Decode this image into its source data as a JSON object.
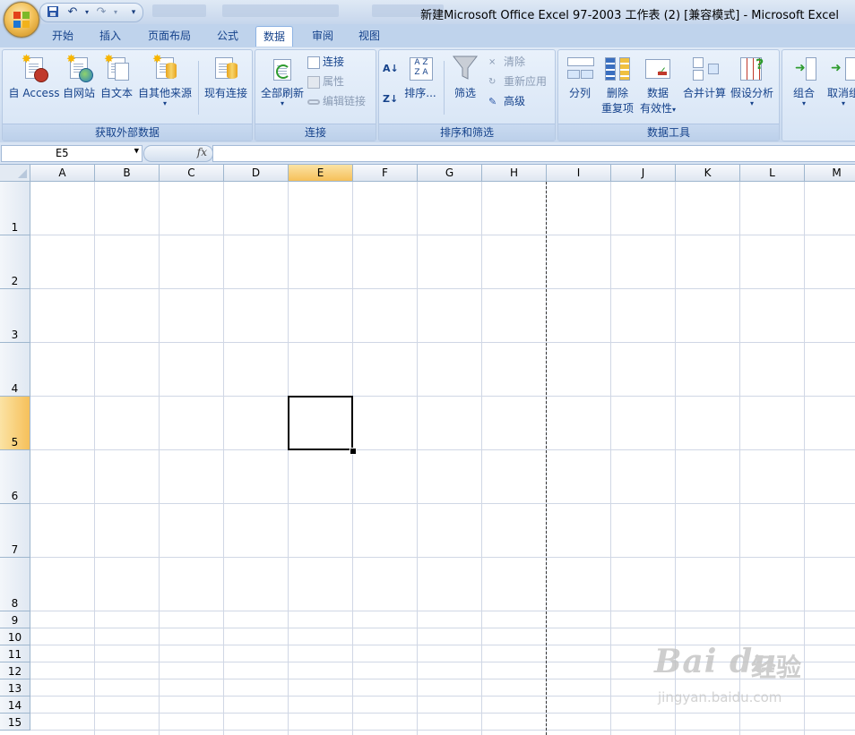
{
  "window": {
    "title": "新建Microsoft Office Excel 97-2003 工作表 (2)  [兼容模式] - Microsoft Excel"
  },
  "quick_access": {
    "icons": [
      "save-icon",
      "undo-icon",
      "redo-icon",
      "customize-icon"
    ]
  },
  "ribbon_tabs": [
    "开始",
    "插入",
    "页面布局",
    "公式",
    "数据",
    "审阅",
    "视图"
  ],
  "active_tab": "数据",
  "groups": {
    "external": {
      "label": "获取外部数据",
      "access": "自 Access",
      "web": "自网站",
      "text": "自文本",
      "other": "自其他来源",
      "existing": "现有连接"
    },
    "connections": {
      "label": "连接",
      "refresh_all": "全部刷新",
      "connections": "连接",
      "properties": "属性",
      "edit_links": "编辑链接"
    },
    "sort_filter": {
      "label": "排序和筛选",
      "sort": "排序...",
      "filter": "筛选",
      "clear": "清除",
      "reapply": "重新应用",
      "advanced": "高级"
    },
    "data_tools": {
      "label": "数据工具",
      "text_to_columns": "分列",
      "remove_dup_1": "删除",
      "remove_dup_2": "重复项",
      "validation_1": "数据",
      "validation_2": "有效性",
      "consolidate": "合并计算",
      "what_if": "假设分析"
    },
    "outline": {
      "group": "组合",
      "ungroup": "取消组"
    }
  },
  "formula_bar": {
    "name_box": "E5",
    "fx_label": "fx",
    "formula": ""
  },
  "sheet": {
    "columns": [
      "A",
      "B",
      "C",
      "D",
      "E",
      "F",
      "G",
      "H",
      "I",
      "J",
      "K",
      "L",
      "M"
    ],
    "rows": [
      "1",
      "2",
      "3",
      "4",
      "5",
      "6",
      "7",
      "8",
      "9",
      "10",
      "11",
      "12",
      "13",
      "14",
      "15"
    ],
    "selected_column": "E",
    "selected_row": "5"
  },
  "watermark": {
    "brand": "Bai du",
    "brand_cn": "经验",
    "url": "jingyan.baidu.com"
  }
}
